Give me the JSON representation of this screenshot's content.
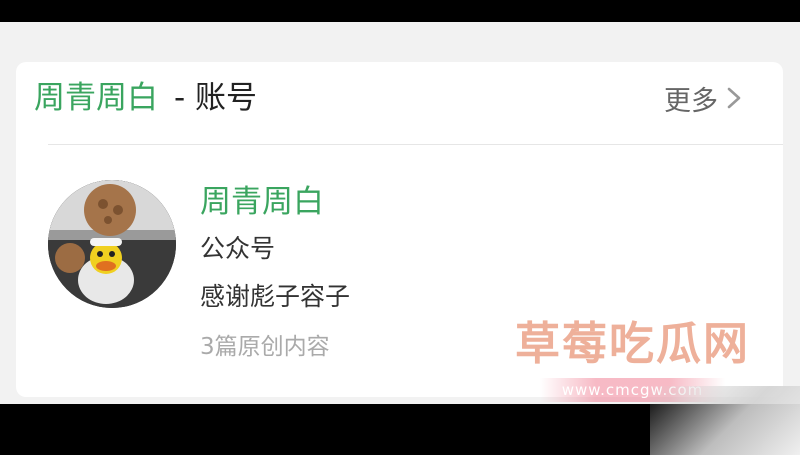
{
  "header": {
    "name": "周青周白",
    "suffix": "- 账号",
    "more_label": "更多"
  },
  "account": {
    "name": "周青周白",
    "type": "公众号",
    "description": "感谢彪子容子",
    "original_count": "3篇原创内容"
  },
  "watermark": {
    "text": "草莓吃瓜网",
    "url": "www.cmcgw.com"
  },
  "colors": {
    "accent_green": "#3aa55f",
    "text_dark": "#222222",
    "text_muted": "#aaaaaa"
  },
  "icons": {
    "more": "chevron-right-icon",
    "avatar": "avatar-image"
  }
}
